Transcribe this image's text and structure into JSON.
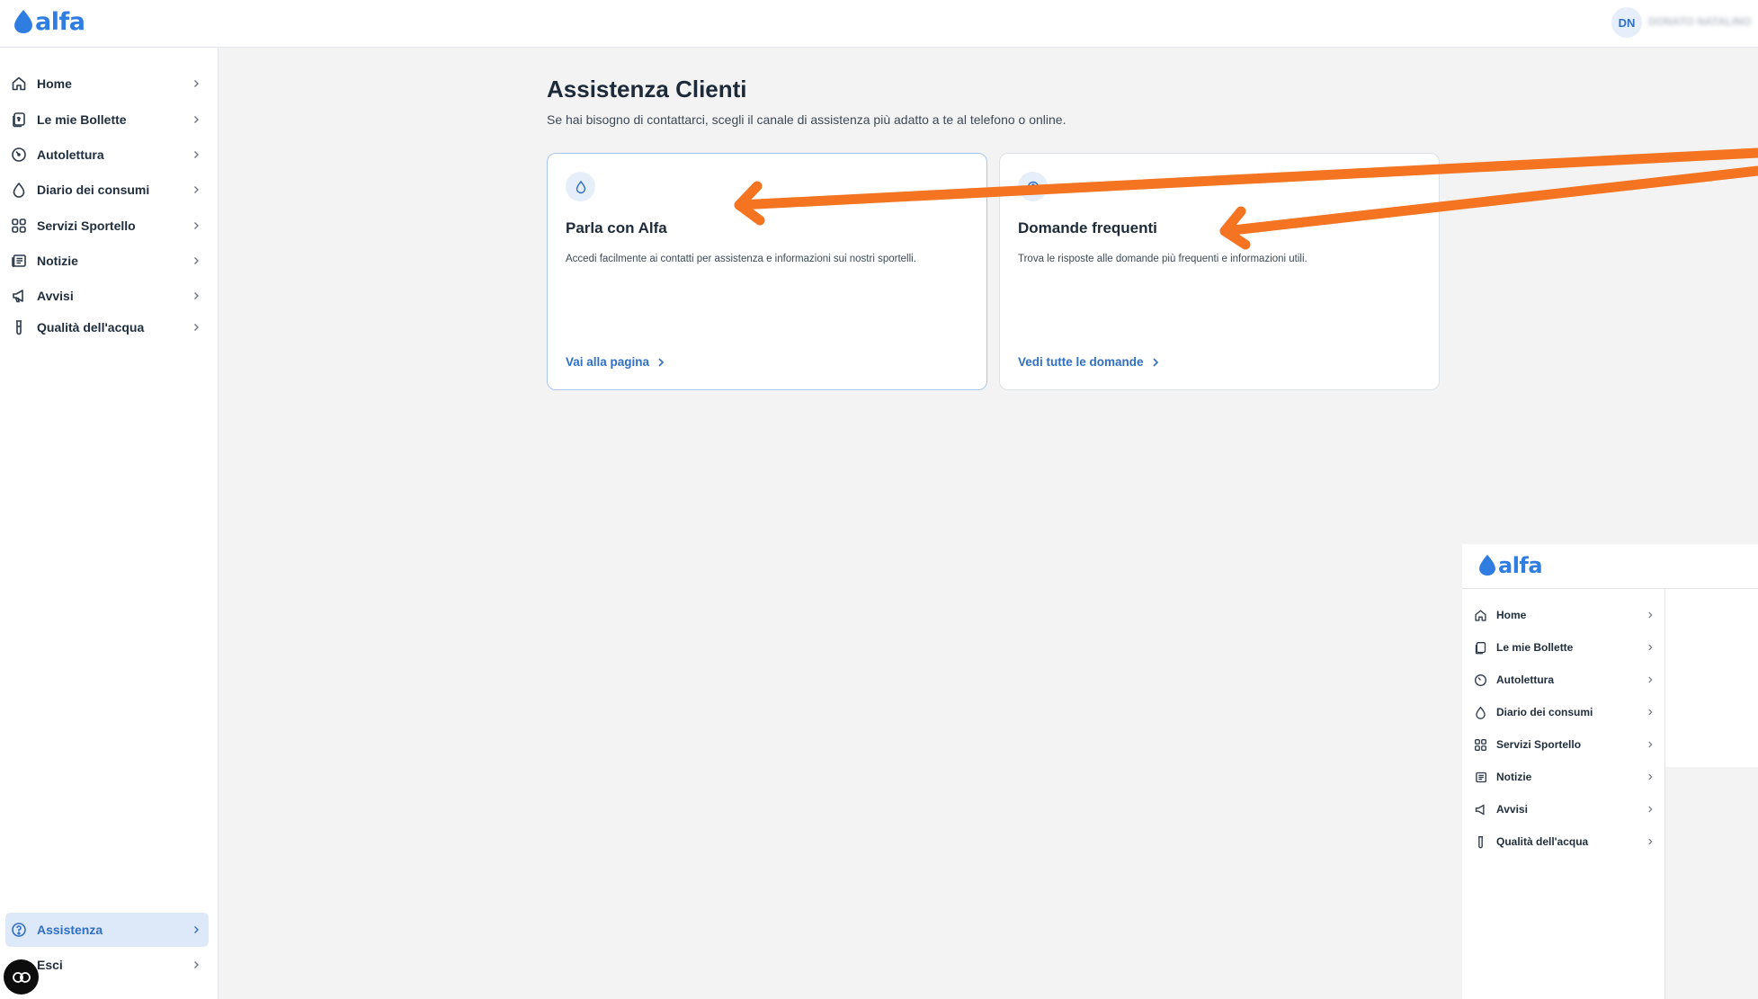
{
  "app": {
    "logo_text": "alfa",
    "user_initials": "DN",
    "user_name": "DONATO NATALINO"
  },
  "sidebar": {
    "items": [
      {
        "label": "Home",
        "icon": "home-icon"
      },
      {
        "label": "Le mie Bollette",
        "icon": "bill-icon"
      },
      {
        "label": "Autolettura",
        "icon": "meter-icon"
      },
      {
        "label": "Diario dei consumi",
        "icon": "drop-icon"
      },
      {
        "label": "Servizi Sportello",
        "icon": "grid-icon"
      },
      {
        "label": "Notizie",
        "icon": "newspaper-icon"
      },
      {
        "label": "Avvisi",
        "icon": "megaphone-icon"
      },
      {
        "label": "Qualità dell'acqua",
        "icon": "test-tube-icon"
      }
    ],
    "bottom_items": [
      {
        "label": "Assistenza",
        "icon": "help-icon",
        "active": true
      },
      {
        "label": "Esci",
        "icon": "logout-icon"
      }
    ]
  },
  "main": {
    "title": "Assistenza Clienti",
    "subtitle": "Se hai bisogno di contattarci, scegli il canale di assistenza più adatto a te al telefono o online.",
    "cards": [
      {
        "icon": "drop-icon",
        "title": "Parla con Alfa",
        "description": "Accedi facilmente ai contatti per assistenza e informazioni sui nostri sportelli.",
        "link": "Vai alla pagina"
      },
      {
        "icon": "faq-icon",
        "title": "Domande frequenti",
        "description": "Trova le risposte alle domande più frequenti e informazioni utili.",
        "link": "Vedi tutte le domande"
      }
    ]
  },
  "colors": {
    "accent": "#2f6fc4",
    "logo_blue": "#2f7de1",
    "annotation_arrow": "#f47422",
    "background": "#f3f3f3"
  }
}
